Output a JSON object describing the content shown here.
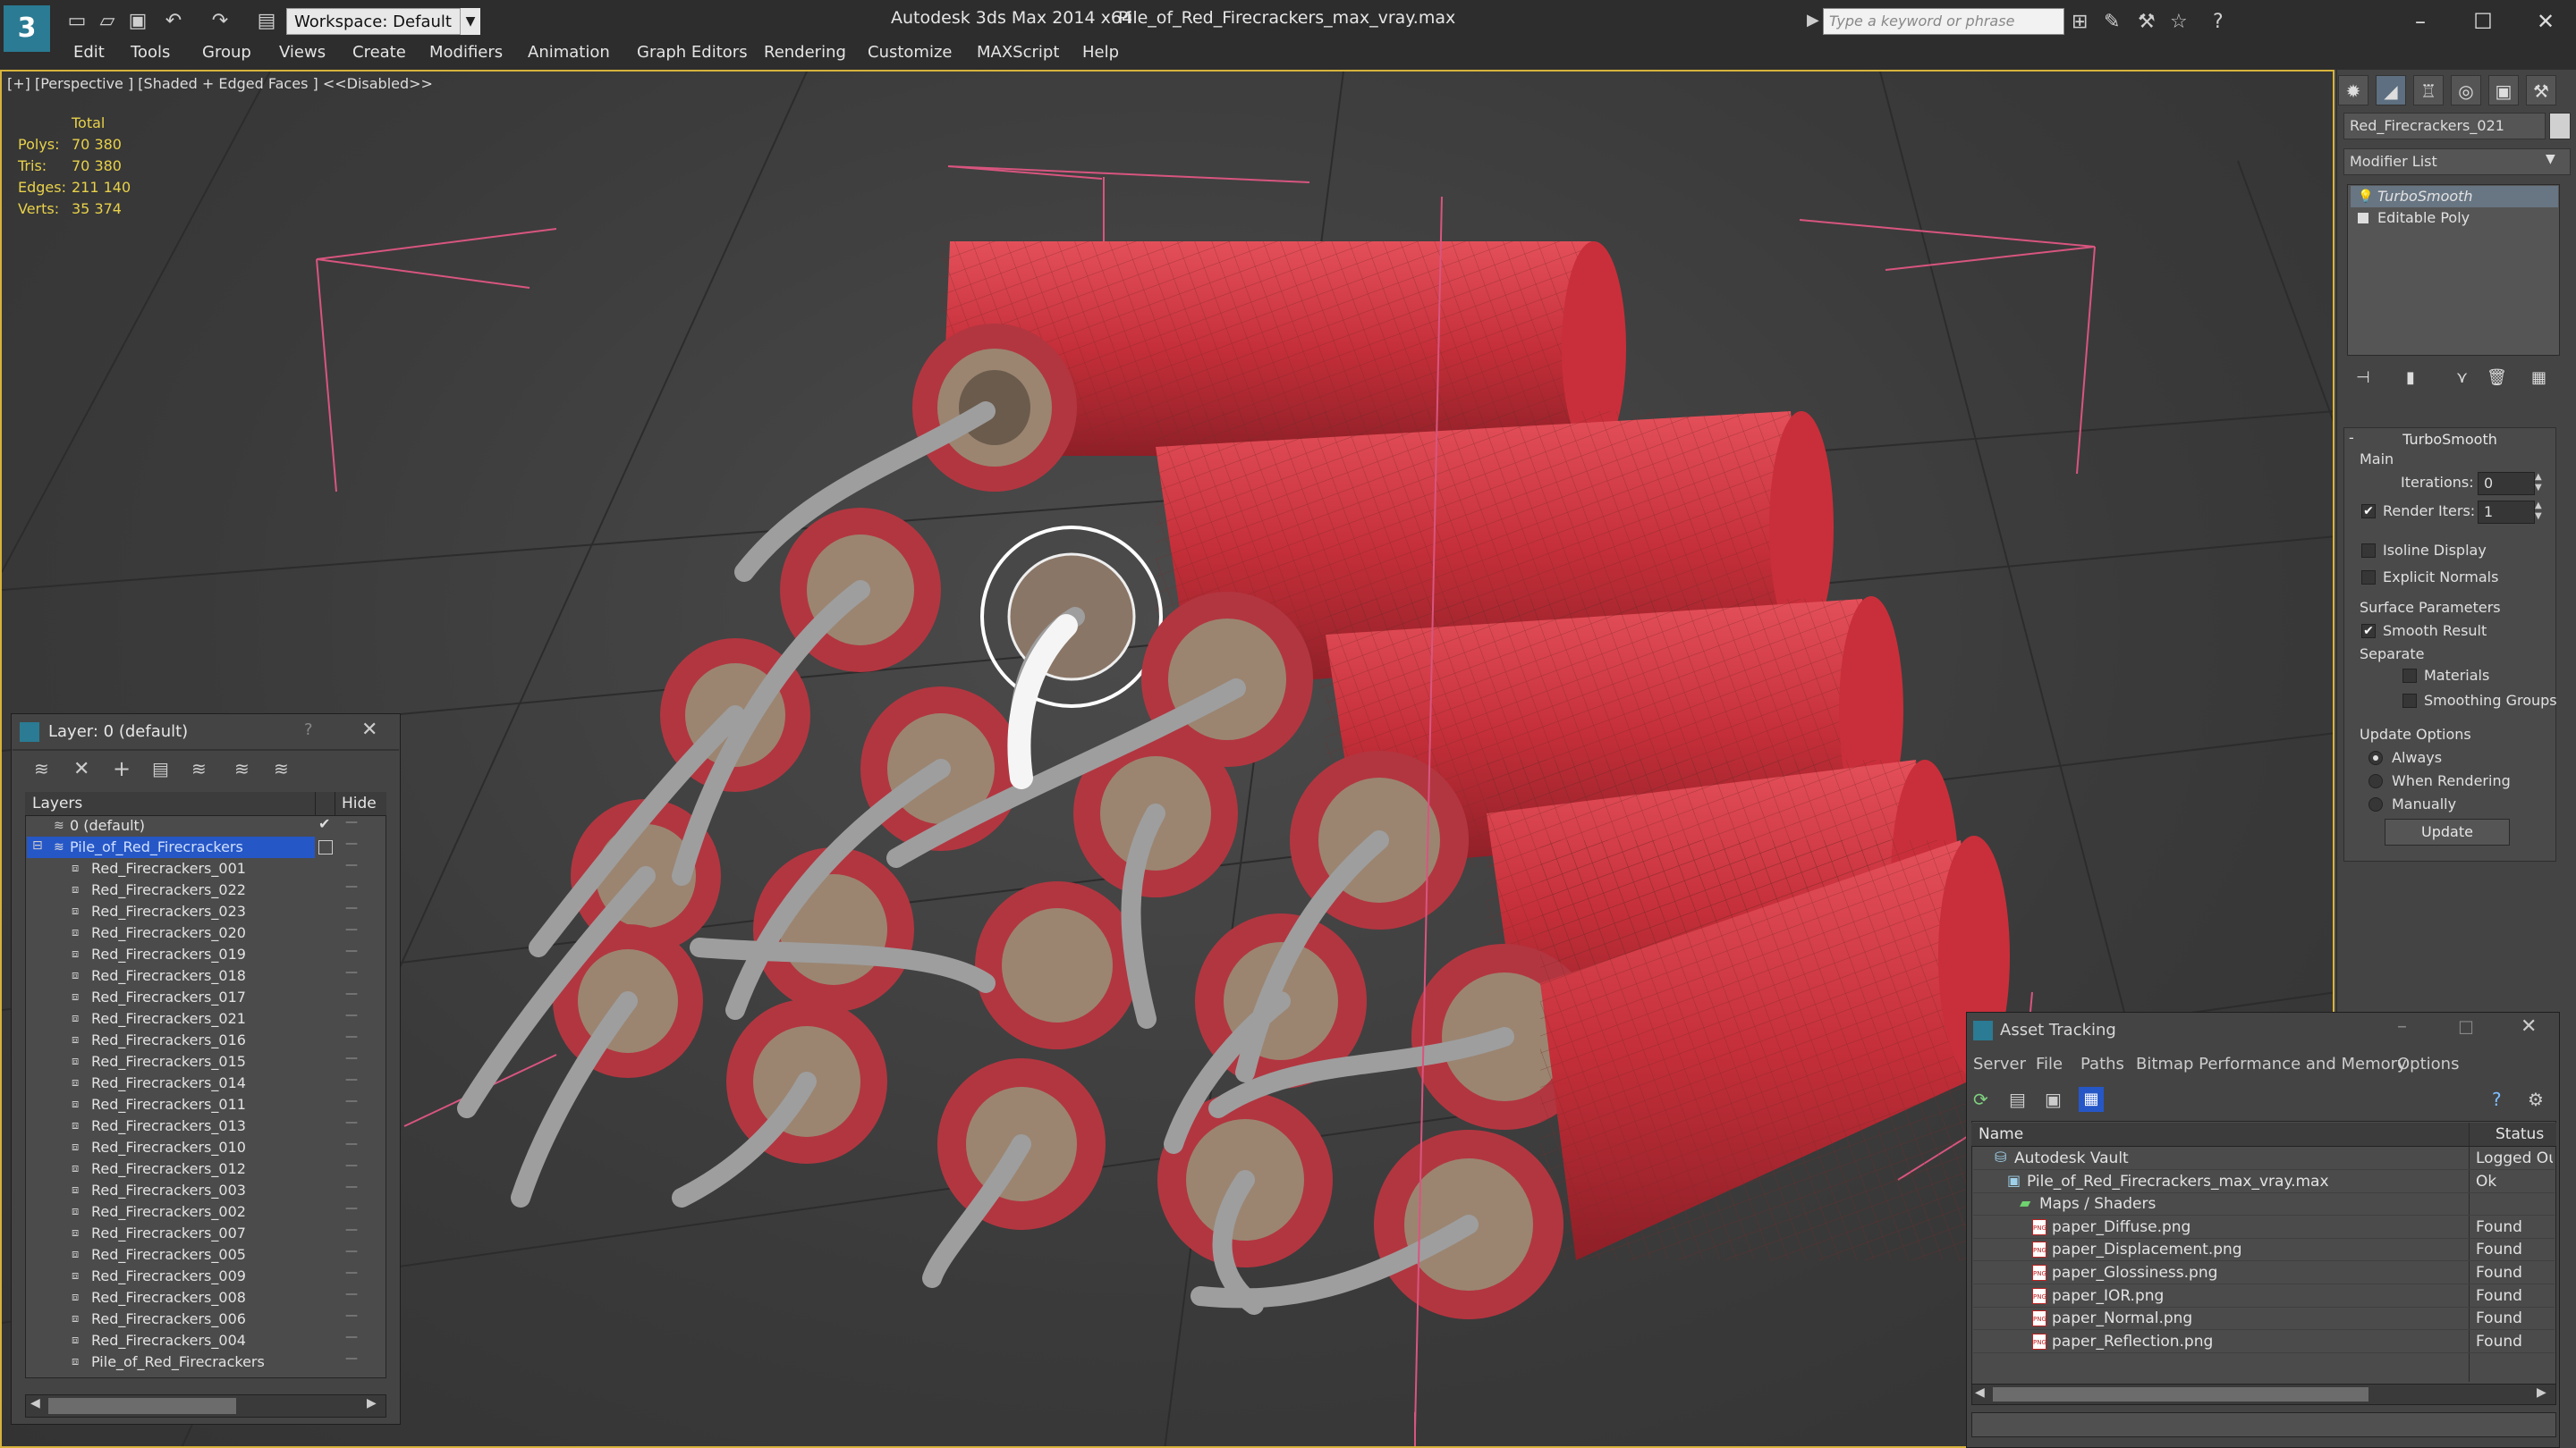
{
  "titlebar": {
    "workspace": "Workspace: Default",
    "app_title": "Autodesk 3ds Max  2014 x64",
    "file_title": "Pile_of_Red_Firecrackers_max_vray.max",
    "search_placeholder": "Type a keyword or phrase",
    "logo": "3"
  },
  "menu": [
    "Edit",
    "Tools",
    "Group",
    "Views",
    "Create",
    "Modifiers",
    "Animation",
    "Graph Editors",
    "Rendering",
    "Customize",
    "MAXScript",
    "Help"
  ],
  "viewport": {
    "label": "[+] [Perspective ] [Shaded + Edged Faces ]  <<Disabled>>",
    "stats": {
      "header": "Total",
      "rows": [
        {
          "label": "Polys:",
          "value": "70 380"
        },
        {
          "label": "Tris:",
          "value": "70 380"
        },
        {
          "label": "Edges:",
          "value": "211 140"
        },
        {
          "label": "Verts:",
          "value": "35 374"
        }
      ]
    }
  },
  "command_panel": {
    "object_name": "Red_Firecrackers_021",
    "modifier_list": "Modifier List",
    "stack": [
      "TurboSmooth",
      "Editable Poly"
    ],
    "turbosmooth": {
      "title": "TurboSmooth",
      "main": "Main",
      "iterations_label": "Iterations:",
      "iterations_value": "0",
      "render_iters_label": "Render Iters:",
      "render_iters_value": "1",
      "isoline": "Isoline Display",
      "explicit_normals": "Explicit Normals",
      "surface_params": "Surface Parameters",
      "smooth_result": "Smooth Result",
      "separate": "Separate",
      "materials": "Materials",
      "smoothing_groups": "Smoothing Groups",
      "update_options": "Update Options",
      "always": "Always",
      "when_rendering": "When Rendering",
      "manually": "Manually",
      "update_button": "Update"
    }
  },
  "layer_window": {
    "title": "Layer: 0 (default)",
    "help": "?",
    "col_layers": "Layers",
    "col_hide": "Hide",
    "default_layer": "0 (default)",
    "selected_layer": "Pile_of_Red_Firecrackers",
    "items": [
      "Red_Firecrackers_001",
      "Red_Firecrackers_022",
      "Red_Firecrackers_023",
      "Red_Firecrackers_020",
      "Red_Firecrackers_019",
      "Red_Firecrackers_018",
      "Red_Firecrackers_017",
      "Red_Firecrackers_021",
      "Red_Firecrackers_016",
      "Red_Firecrackers_015",
      "Red_Firecrackers_014",
      "Red_Firecrackers_011",
      "Red_Firecrackers_013",
      "Red_Firecrackers_010",
      "Red_Firecrackers_012",
      "Red_Firecrackers_003",
      "Red_Firecrackers_002",
      "Red_Firecrackers_007",
      "Red_Firecrackers_005",
      "Red_Firecrackers_009",
      "Red_Firecrackers_008",
      "Red_Firecrackers_006",
      "Red_Firecrackers_004",
      "Pile_of_Red_Firecrackers"
    ],
    "hide_mark": "—"
  },
  "asset_window": {
    "title": "Asset Tracking",
    "menu": [
      "Server",
      "File",
      "Paths",
      "Bitmap Performance and Memory",
      "Options"
    ],
    "col_name": "Name",
    "col_status": "Status",
    "rows": [
      {
        "name": "Autodesk Vault",
        "status": "Logged Ou",
        "indent": 0,
        "kind": "vault"
      },
      {
        "name": "Pile_of_Red_Firecrackers_max_vray.max",
        "status": "Ok",
        "indent": 1,
        "kind": "max"
      },
      {
        "name": "Maps / Shaders",
        "status": "",
        "indent": 2,
        "kind": "folder"
      },
      {
        "name": "paper_Diffuse.png",
        "status": "Found",
        "indent": 3,
        "kind": "png"
      },
      {
        "name": "paper_Displacement.png",
        "status": "Found",
        "indent": 3,
        "kind": "png"
      },
      {
        "name": "paper_Glossiness.png",
        "status": "Found",
        "indent": 3,
        "kind": "png"
      },
      {
        "name": "paper_IOR.png",
        "status": "Found",
        "indent": 3,
        "kind": "png"
      },
      {
        "name": "paper_Normal.png",
        "status": "Found",
        "indent": 3,
        "kind": "png"
      },
      {
        "name": "paper_Reflection.png",
        "status": "Found",
        "indent": 3,
        "kind": "png"
      }
    ]
  },
  "colors": {
    "accent": "#2a7b93",
    "selection": "#2657c7",
    "firecracker_red": "#d83a44",
    "stat_yellow": "#e8d14a",
    "viewport_border": "#d7b33b"
  }
}
